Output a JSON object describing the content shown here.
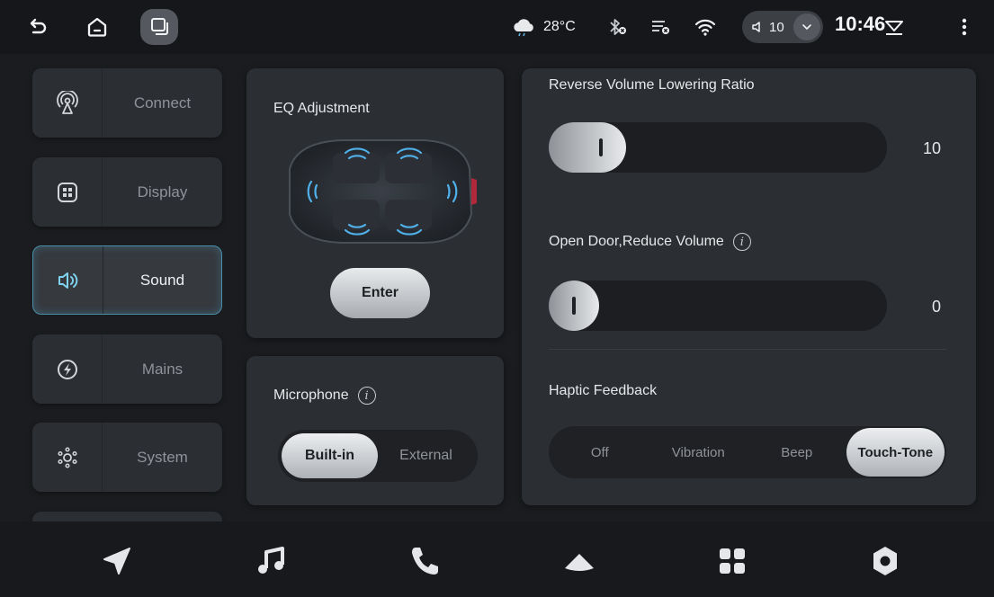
{
  "status_bar": {
    "temperature": "28°C",
    "volume_level": "10",
    "time": "10:46"
  },
  "nav": {
    "items": [
      {
        "label": "Connect",
        "icon": "satellite-icon",
        "active": false
      },
      {
        "label": "Display",
        "icon": "grid-icon",
        "active": false
      },
      {
        "label": "Sound",
        "icon": "speaker-icon",
        "active": true
      },
      {
        "label": "Mains",
        "icon": "lightning-icon",
        "active": false
      },
      {
        "label": "System",
        "icon": "system-icon",
        "active": false
      }
    ]
  },
  "eq_card": {
    "title": "EQ Adjustment",
    "enter_label": "Enter"
  },
  "mic_card": {
    "title": "Microphone",
    "options": [
      "Built-in",
      "External"
    ],
    "selected": "Built-in"
  },
  "sound_panel": {
    "reverse_title": "Reverse Volume Lowering Ratio",
    "reverse_value": "10",
    "reverse_fraction": 0.23,
    "door_title": "Open Door,Reduce Volume",
    "door_value": "0",
    "door_fraction": 0.08,
    "haptic_title": "Haptic Feedback",
    "haptic_options": [
      "Off",
      "Vibration",
      "Beep",
      "Touch-Tone"
    ],
    "haptic_selected": "Touch-Tone"
  },
  "colors": {
    "accent": "#4a8ea8",
    "background": "#1a1c1f",
    "card": "#2b2e32"
  }
}
